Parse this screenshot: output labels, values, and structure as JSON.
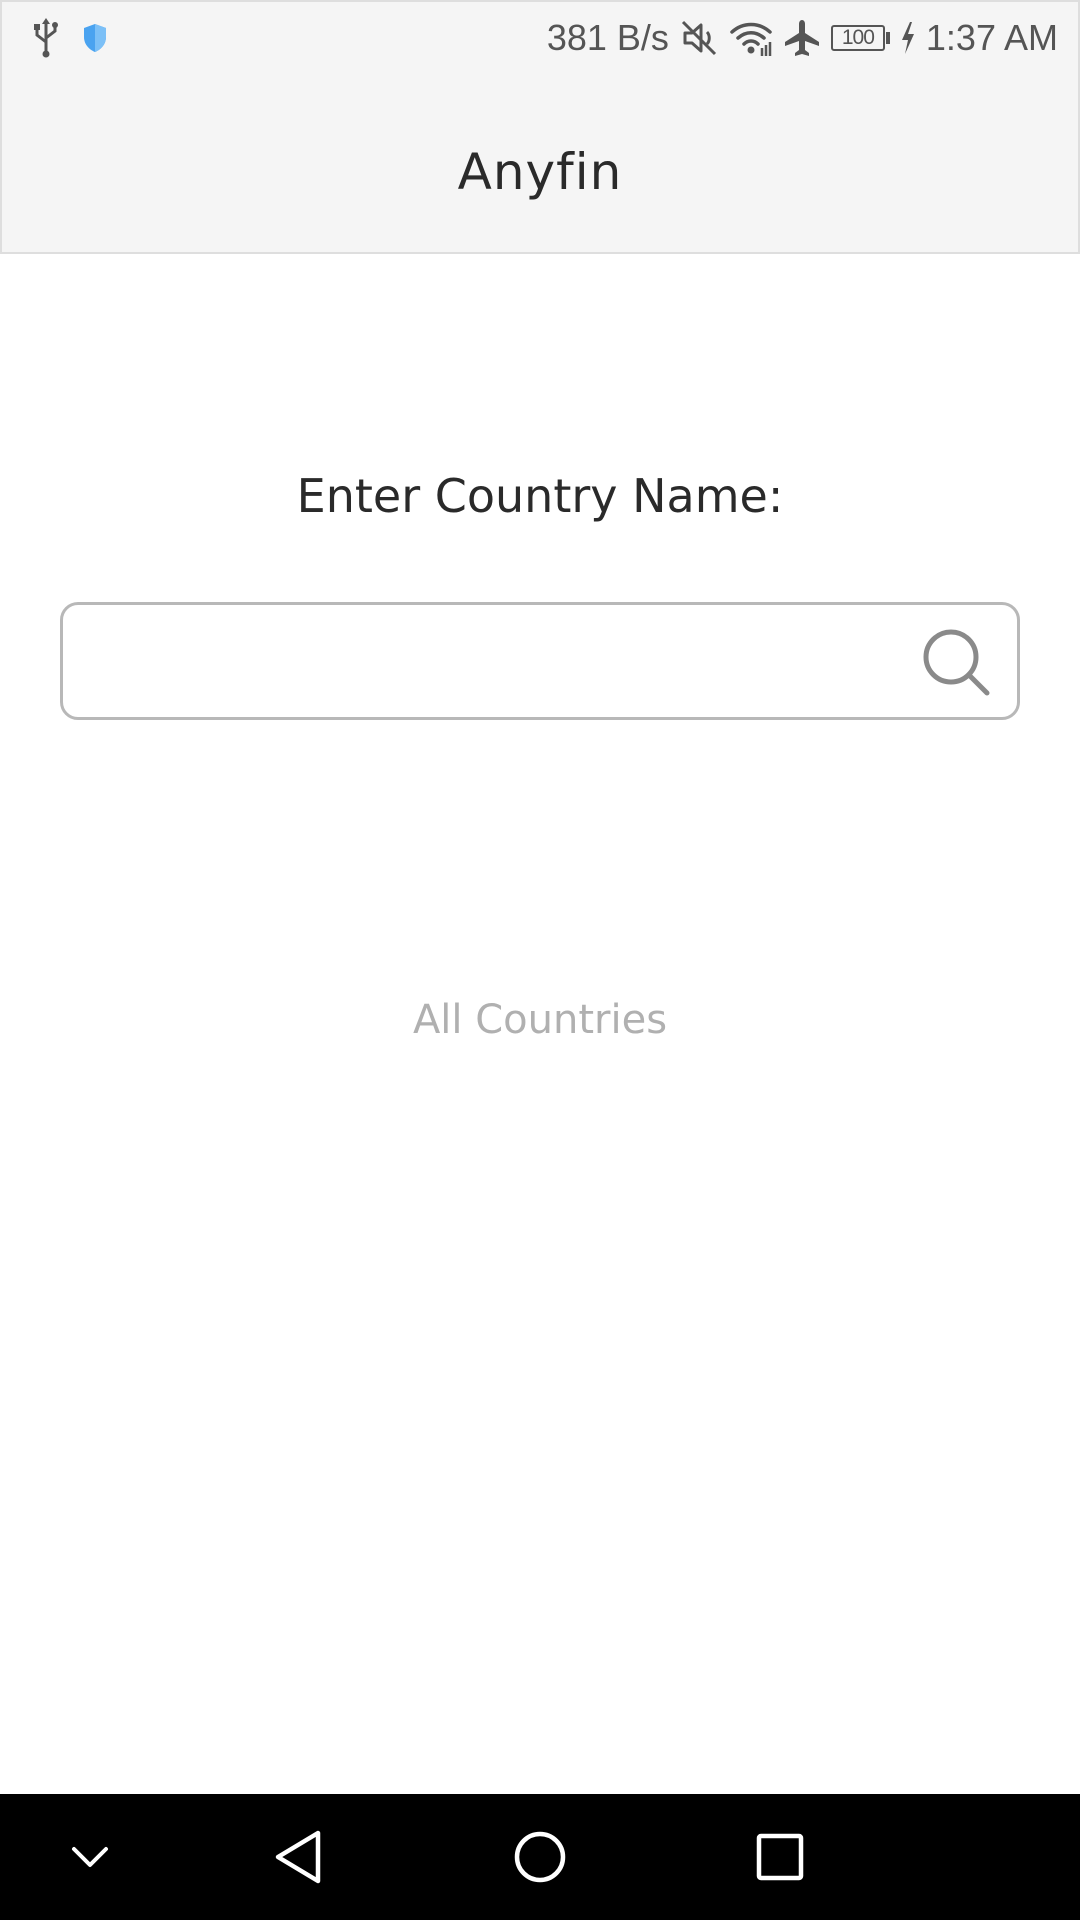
{
  "status_bar": {
    "left_icons": [
      "usb-icon",
      "shield-icon"
    ],
    "network_speed": "381 B/s",
    "right_icons": [
      "mute-icon",
      "wifi-icon",
      "airplane-icon",
      "battery-icon",
      "charging-icon"
    ],
    "battery_level": "100",
    "time": "1:37 AM",
    "shield_color": "#4aa3f0"
  },
  "app_bar": {
    "title": "Anyfin"
  },
  "main": {
    "prompt_label": "Enter Country Name:",
    "search": {
      "value": "",
      "placeholder": "",
      "icon": "search-icon"
    },
    "all_countries_link": "All Countries"
  },
  "nav_bar": {
    "buttons": [
      "collapse-icon",
      "back-icon",
      "home-icon",
      "recents-icon"
    ]
  },
  "colors": {
    "accent": "#2a2a2a",
    "muted": "#b0b0b0",
    "chrome_background": "#f5f5f5",
    "nav_background": "#000000"
  }
}
